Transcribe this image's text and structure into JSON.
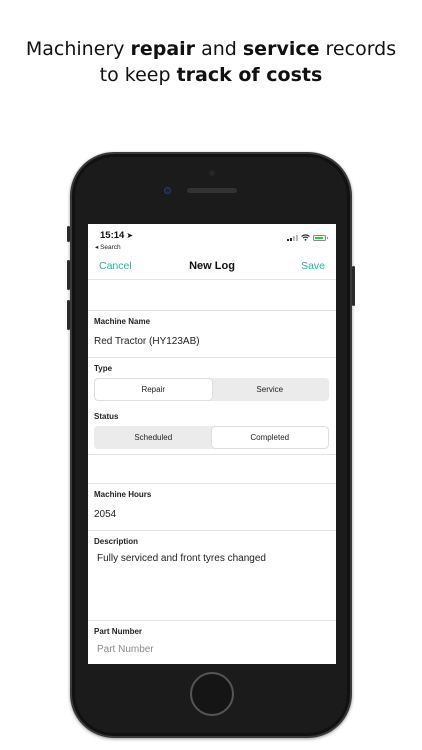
{
  "headline": {
    "line1_a": "Machinery ",
    "line1_b": "repair",
    "line1_c": " and ",
    "line1_d": "service",
    "line1_e": " records",
    "line2_a": "to keep ",
    "line2_b": "track of costs"
  },
  "status_bar": {
    "time": "15:14",
    "back_label": "◂ Search"
  },
  "nav": {
    "cancel": "Cancel",
    "title": "New Log",
    "save": "Save"
  },
  "form": {
    "machine_name_label": "Machine Name",
    "machine_name_value": "Red Tractor (HY123AB)",
    "type_label": "Type",
    "type_options": [
      "Repair",
      "Service"
    ],
    "type_selected": "Repair",
    "status_label": "Status",
    "status_options": [
      "Scheduled",
      "Completed"
    ],
    "status_selected": "Completed",
    "machine_hours_label": "Machine Hours",
    "machine_hours_value": "2054",
    "description_label": "Description",
    "description_value": "Fully serviced and front tyres changed",
    "part_number_label": "Part Number",
    "part_number_placeholder": "Part Number"
  },
  "colors": {
    "accent": "#2bb3a3",
    "battery": "#2ecc40"
  }
}
